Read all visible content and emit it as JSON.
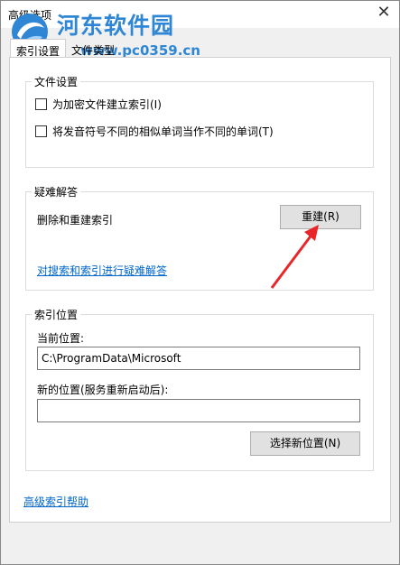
{
  "window": {
    "title": "高级选项",
    "close_symbol": "✕"
  },
  "watermark": {
    "title": "河东软件园",
    "url": "www.pc0359.cn"
  },
  "tabs": [
    {
      "label": "索引设置",
      "active": true
    },
    {
      "label": "文件类型",
      "active": false
    }
  ],
  "file_settings": {
    "title": "文件设置",
    "checkbox1": "为加密文件建立索引(I)",
    "checkbox2": "将发音符号不同的相似单词当作不同的单词(T)"
  },
  "troubleshoot": {
    "title": "疑难解答",
    "label": "删除和重建索引",
    "rebuild_button": "重建(R)",
    "link": "对搜索和索引进行疑难解答"
  },
  "index_location": {
    "title": "索引位置",
    "current_label": "当前位置:",
    "current_value": "C:\\ProgramData\\Microsoft",
    "new_label": "新的位置(服务重新启动后):",
    "new_value": "",
    "select_button": "选择新位置(N)"
  },
  "help_link": "高级索引帮助",
  "colors": {
    "accent_link": "#0066cc",
    "watermark": "#2f86d4",
    "arrow": "#e8262a"
  }
}
